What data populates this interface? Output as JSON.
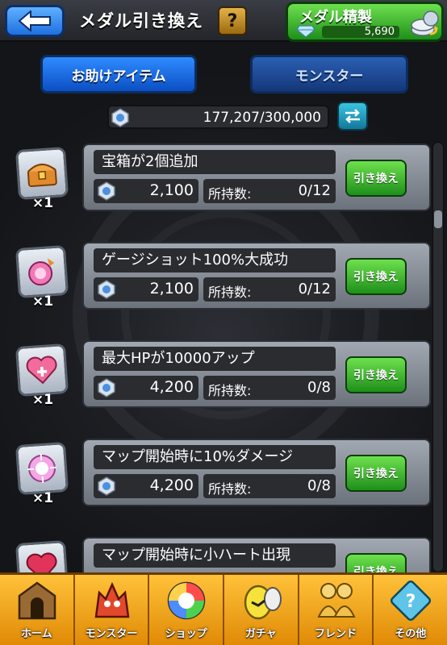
{
  "header": {
    "title": "メダル引き換え",
    "help_label": "?",
    "craft_label": "メダル精製",
    "diamond_count": "5,690"
  },
  "tabs": [
    {
      "label": "お助けアイテム",
      "active": true
    },
    {
      "label": "モンスター",
      "active": false
    }
  ],
  "balance": "177,207/300,000",
  "items": [
    {
      "name": "宝箱が2個追加",
      "qty": "×1",
      "cost": "2,100",
      "owned_label": "所持数:",
      "owned": "0/12",
      "button": "引き換え",
      "icon": "treasure-chest-icon"
    },
    {
      "name": "ゲージショット100%大成功",
      "qty": "×1",
      "cost": "2,100",
      "owned_label": "所持数:",
      "owned": "0/12",
      "button": "引き換え",
      "icon": "gauge-shot-icon"
    },
    {
      "name": "最大HPが10000アップ",
      "qty": "×1",
      "cost": "4,200",
      "owned_label": "所持数:",
      "owned": "0/8",
      "button": "引き換え",
      "icon": "heart-plus-icon"
    },
    {
      "name": "マップ開始時に10%ダメージ",
      "qty": "×1",
      "cost": "4,200",
      "owned_label": "所持数:",
      "owned": "0/8",
      "button": "引き換え",
      "icon": "damage-orb-icon"
    },
    {
      "name": "マップ開始時に小ハート出現",
      "qty": "",
      "cost": "",
      "owned_label": "",
      "owned": "",
      "button": "引き換え",
      "icon": "small-heart-icon"
    }
  ],
  "nav": [
    {
      "label": "ホーム",
      "icon": "home-icon"
    },
    {
      "label": "モンスター",
      "icon": "monster-icon"
    },
    {
      "label": "ショップ",
      "icon": "shop-orb-icon"
    },
    {
      "label": "ガチャ",
      "icon": "gacha-egg-icon"
    },
    {
      "label": "フレンド",
      "icon": "friends-icon"
    },
    {
      "label": "その他",
      "icon": "other-icon"
    }
  ],
  "colors": {
    "green_button": "#1e8f1a",
    "blue_tab": "#0b4fc4",
    "nav_orange": "#e08a06"
  }
}
